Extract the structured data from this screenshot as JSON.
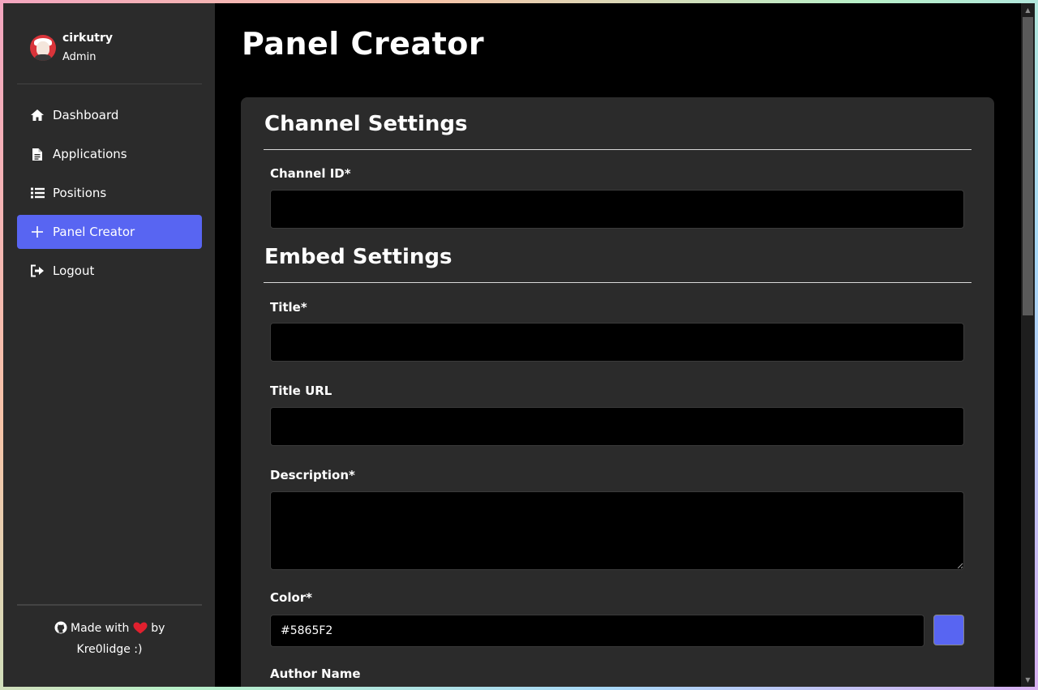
{
  "user": {
    "name": "cirkutry",
    "role": "Admin"
  },
  "sidebar": {
    "items": [
      {
        "label": "Dashboard",
        "icon": "home-icon"
      },
      {
        "label": "Applications",
        "icon": "document-icon"
      },
      {
        "label": "Positions",
        "icon": "list-icon"
      },
      {
        "label": "Panel Creator",
        "icon": "plus-icon",
        "active": true
      },
      {
        "label": "Logout",
        "icon": "logout-icon"
      }
    ],
    "credits_prefix": "Made with",
    "credits_by": "by",
    "credits_author": "Kre0lidge :)"
  },
  "page": {
    "title": "Panel Creator"
  },
  "channel_settings": {
    "title": "Channel Settings",
    "channel_id_label": "Channel ID*",
    "channel_id_value": ""
  },
  "embed_settings": {
    "title": "Embed Settings",
    "title_label": "Title*",
    "title_value": "",
    "title_url_label": "Title URL",
    "title_url_value": "",
    "description_label": "Description*",
    "description_value": "",
    "color_label": "Color*",
    "color_value": "#5865F2",
    "author_name_label": "Author Name"
  },
  "colors": {
    "accent": "#5865f2",
    "sidebar_bg": "#2b2b2b",
    "card_bg": "#2b2b2b",
    "page_bg": "#000000",
    "heart": "#e0202e"
  }
}
